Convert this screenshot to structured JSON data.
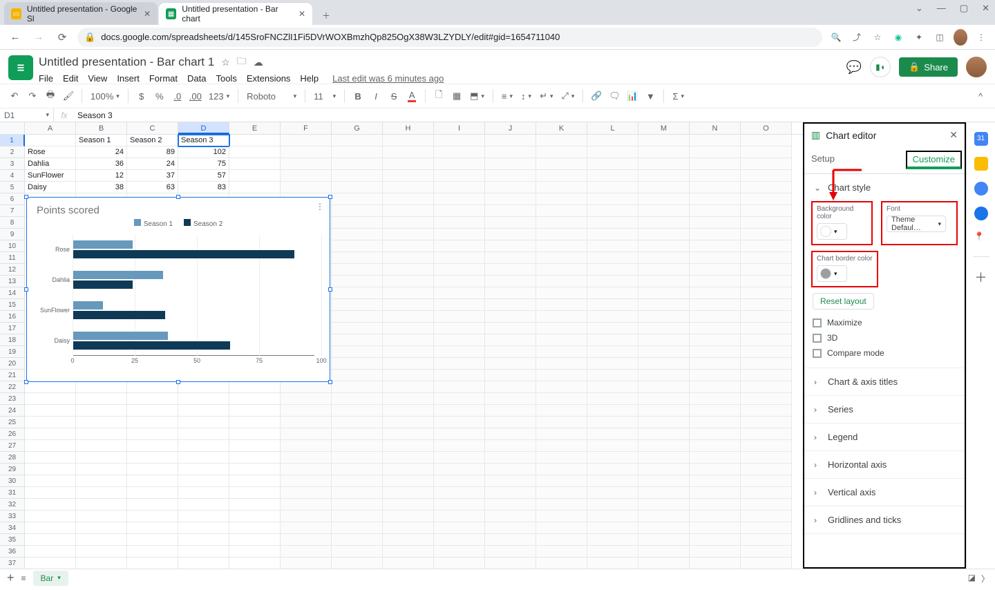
{
  "browser": {
    "tabs": [
      {
        "title": "Untitled presentation - Google Sl",
        "favBg": "#f4b400"
      },
      {
        "title": "Untitled presentation - Bar chart",
        "favBg": "#0f9d58"
      }
    ],
    "url": "docs.google.com/spreadsheets/d/145SroFNCZlI1Fi5DVrWOXBmzhQp825OgX38W3LZYDLY/edit#gid=1654711040"
  },
  "doc": {
    "title": "Untitled presentation - Bar chart 1",
    "menus": [
      "File",
      "Edit",
      "View",
      "Insert",
      "Format",
      "Data",
      "Tools",
      "Extensions",
      "Help"
    ],
    "lastEdit": "Last edit was 6 minutes ago",
    "share": "Share"
  },
  "toolbar": {
    "zoom": "100%",
    "currency": "$",
    "percent": "%",
    "decDec": ".0",
    "incDec": ".00",
    "numFmt": "123",
    "font": "Roboto",
    "fontSize": "11"
  },
  "formula": {
    "cellRef": "D1",
    "value": "Season 3"
  },
  "columns": [
    "A",
    "B",
    "C",
    "D",
    "E",
    "F",
    "G",
    "H",
    "I",
    "J",
    "K",
    "L",
    "M",
    "N",
    "O"
  ],
  "data": {
    "headers": [
      "",
      "Season 1",
      "Season 2",
      "Season 3"
    ],
    "rows": [
      {
        "label": "Rose",
        "v": [
          24,
          89,
          102
        ]
      },
      {
        "label": "Dahlia",
        "v": [
          36,
          24,
          75
        ]
      },
      {
        "label": "SunFlower",
        "v": [
          12,
          37,
          57
        ]
      },
      {
        "label": "Daisy",
        "v": [
          38,
          63,
          83
        ]
      }
    ]
  },
  "chart_data": {
    "type": "bar",
    "title": "Points scored",
    "orientation": "horizontal",
    "categories": [
      "Rose",
      "Dahlia",
      "SunFlower",
      "Daisy"
    ],
    "series": [
      {
        "name": "Season 1",
        "color": "#6699bc",
        "values": [
          24,
          36,
          12,
          38
        ]
      },
      {
        "name": "Season 2",
        "color": "#0f3a57",
        "values": [
          89,
          24,
          37,
          63
        ]
      }
    ],
    "xTicks": [
      0,
      25,
      50,
      75,
      100
    ],
    "xlim": [
      0,
      100
    ]
  },
  "editor": {
    "title": "Chart editor",
    "tabs": {
      "setup": "Setup",
      "customize": "Customize"
    },
    "chartStyle": "Chart style",
    "bgColor": "Background color",
    "font": "Font",
    "fontValue": "Theme Defaul…",
    "borderColor": "Chart border color",
    "reset": "Reset layout",
    "checks": [
      "Maximize",
      "3D",
      "Compare mode"
    ],
    "sections": [
      "Chart & axis titles",
      "Series",
      "Legend",
      "Horizontal axis",
      "Vertical axis",
      "Gridlines and ticks"
    ]
  },
  "sheet": {
    "name": "Bar",
    "addLabel": "+",
    "menuLabel": "≡"
  }
}
